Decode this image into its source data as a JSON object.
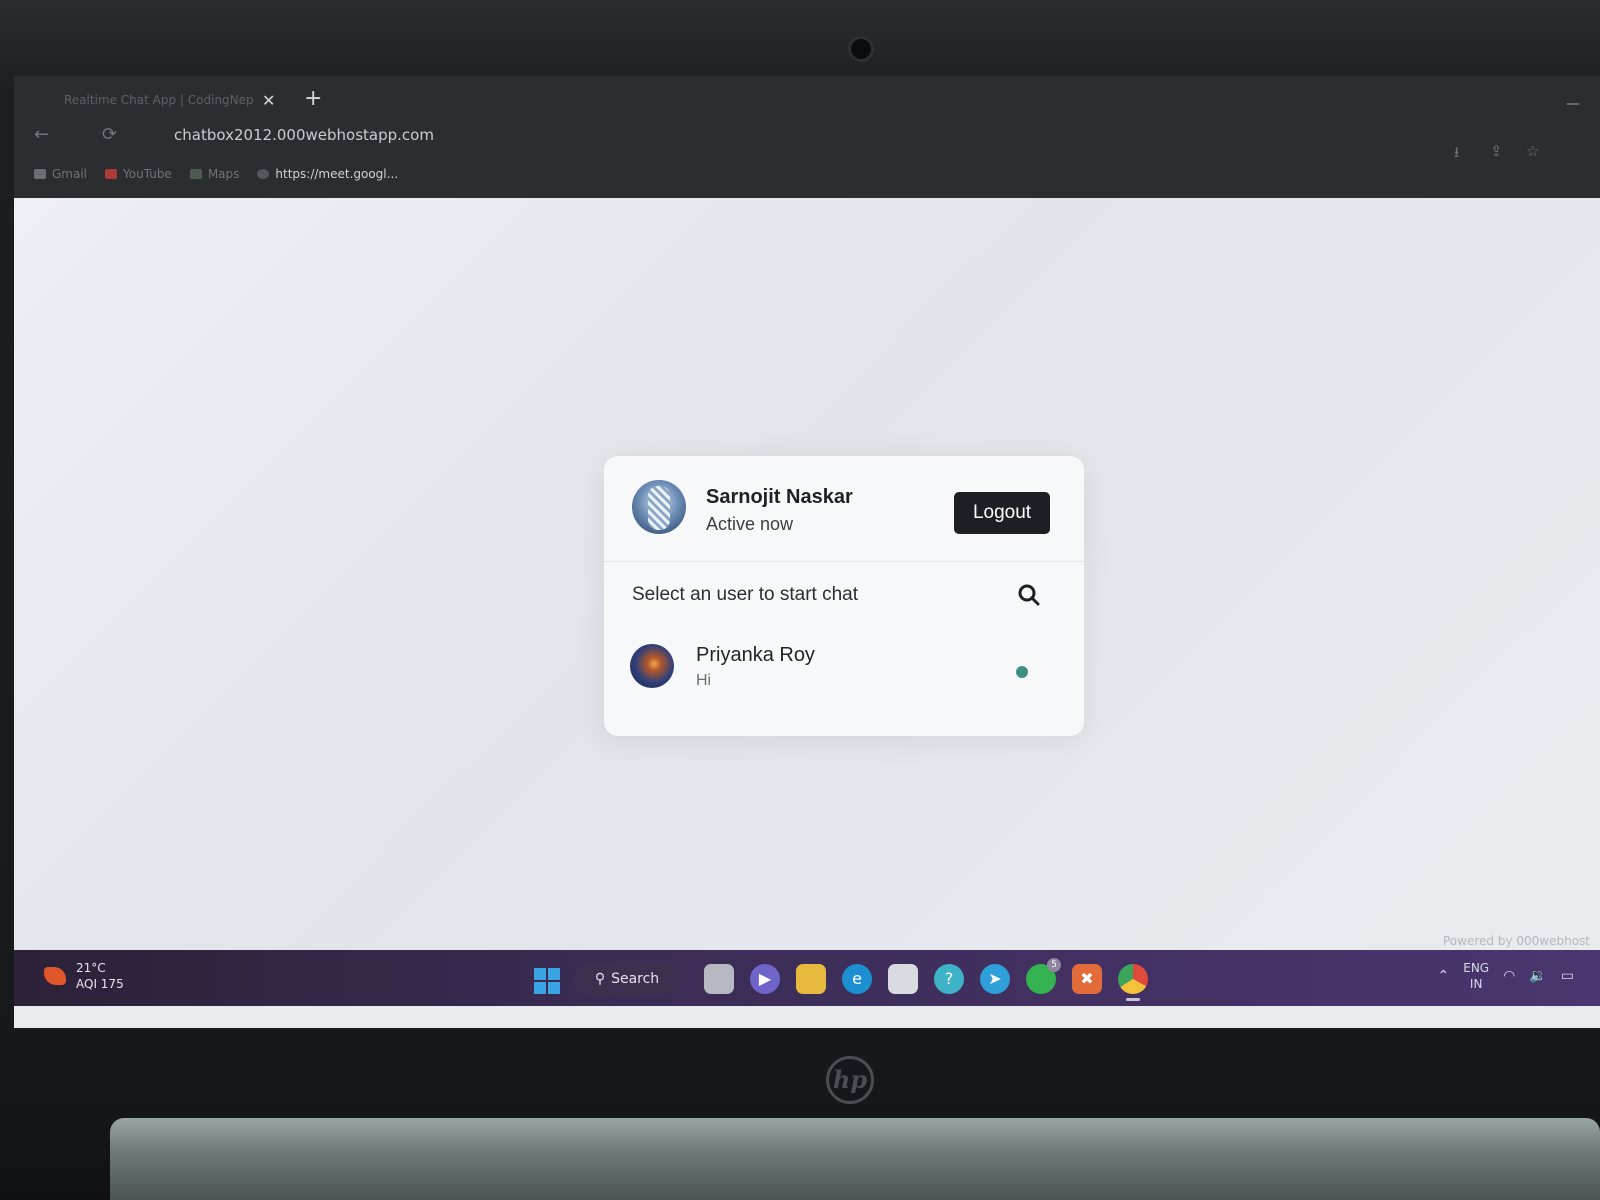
{
  "browser": {
    "tab_title": "Realtime Chat App | CodingNepal",
    "tab_close": "✕",
    "new_tab": "+",
    "url": "chatbox2012.000webhostapp.com",
    "bookmarks": [
      {
        "label": "Gmail",
        "color": "#d14836"
      },
      {
        "label": "YouTube",
        "color": "#e62117"
      },
      {
        "label": "Maps",
        "color": "#3b9d5a"
      },
      {
        "label": "https://meet.googl...",
        "color": "#5f6368"
      }
    ]
  },
  "chat": {
    "current_user": {
      "name": "Sarnojit Naskar",
      "status": "Active now"
    },
    "logout_label": "Logout",
    "search_placeholder": "Select an user to start chat",
    "users": [
      {
        "name": "Priyanka Roy",
        "last_message": "Hi",
        "online": true,
        "status_color": "#3e8e83"
      }
    ]
  },
  "footer": {
    "powered_by": "Powered by  000webhost"
  },
  "taskbar": {
    "weather_temp": "21°C",
    "weather_aqi": "AQI 175",
    "search_label": "Search",
    "whatsapp_badge": "5",
    "lang_line1": "ENG",
    "lang_line2": "IN"
  },
  "device": {
    "logo": "hp"
  }
}
